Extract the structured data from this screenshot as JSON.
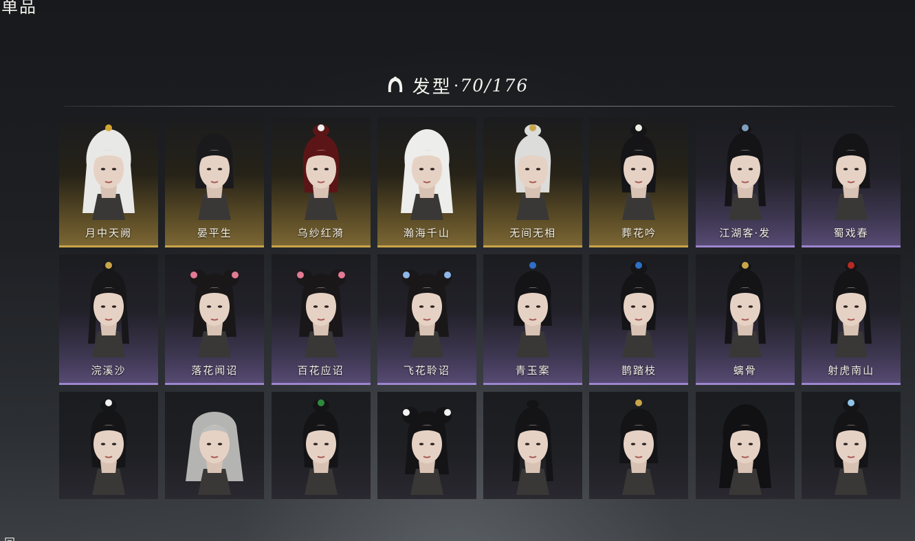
{
  "corner": {
    "title": "单品",
    "bottom_char": "回"
  },
  "header": {
    "title": "发型",
    "separator": "·",
    "count": "70/176"
  },
  "colors": {
    "gold": "#c9a54a",
    "purple": "#9e86cf"
  },
  "items": [
    {
      "label": "月中天阙",
      "rarity": "gold",
      "hair": "#e8e8e6",
      "accent": "#d4a636",
      "style": "long"
    },
    {
      "label": "晏平生",
      "rarity": "gold",
      "hair": "#1a1a1d",
      "accent": "",
      "style": "short"
    },
    {
      "label": "乌纱红漪",
      "rarity": "gold",
      "hair": "#5c1516",
      "accent": "#f0f0f0",
      "style": "bun"
    },
    {
      "label": "瀚海千山",
      "rarity": "gold",
      "hair": "#ededeb",
      "accent": "",
      "style": "long"
    },
    {
      "label": "无间无相",
      "rarity": "gold",
      "hair": "#dcdcda",
      "accent": "#c9a54a",
      "style": "bun"
    },
    {
      "label": "葬花吟",
      "rarity": "gold",
      "hair": "#151518",
      "accent": "#f0ede4",
      "style": "bun"
    },
    {
      "label": "江湖客·发",
      "rarity": "purple",
      "hair": "#141417",
      "accent": "#7f9fbf",
      "style": "pony"
    },
    {
      "label": "蜀戏春",
      "rarity": "purple",
      "hair": "#141417",
      "accent": "",
      "style": "short"
    },
    {
      "label": "浣溪沙",
      "rarity": "purple",
      "hair": "#171619",
      "accent": "#c9a54a",
      "style": "pony"
    },
    {
      "label": "落花闻诏",
      "rarity": "purple",
      "hair": "#1a1719",
      "accent": "#e27a93",
      "style": "buns"
    },
    {
      "label": "百花应诏",
      "rarity": "purple",
      "hair": "#1a1719",
      "accent": "#e27a93",
      "style": "buns"
    },
    {
      "label": "飞花聆诏",
      "rarity": "purple",
      "hair": "#1a1719",
      "accent": "#8fb6e8",
      "style": "buns"
    },
    {
      "label": "青玉案",
      "rarity": "purple",
      "hair": "#141417",
      "accent": "#2f6fc4",
      "style": "short"
    },
    {
      "label": "鹊踏枝",
      "rarity": "purple",
      "hair": "#141417",
      "accent": "#2f6fc4",
      "style": "bun"
    },
    {
      "label": "螭骨",
      "rarity": "purple",
      "hair": "#141417",
      "accent": "#c9a54a",
      "style": "pony"
    },
    {
      "label": "射虎南山",
      "rarity": "purple",
      "hair": "#141417",
      "accent": "#b62a22",
      "style": "pony"
    },
    {
      "label": "",
      "rarity": "plain",
      "hair": "#151518",
      "accent": "#f0f0f0",
      "style": "bun"
    },
    {
      "label": "",
      "rarity": "plain",
      "hair": "#bdbdbb",
      "accent": "",
      "style": "veil"
    },
    {
      "label": "",
      "rarity": "plain",
      "hair": "#141417",
      "accent": "#2f8a3a",
      "style": "bun"
    },
    {
      "label": "",
      "rarity": "plain",
      "hair": "#141417",
      "accent": "#f2f2f2",
      "style": "buns"
    },
    {
      "label": "",
      "rarity": "plain",
      "hair": "#141417",
      "accent": "",
      "style": "pony"
    },
    {
      "label": "",
      "rarity": "plain",
      "hair": "#141417",
      "accent": "#c9a54a",
      "style": "short"
    },
    {
      "label": "",
      "rarity": "plain",
      "hair": "#111114",
      "accent": "",
      "style": "long"
    },
    {
      "label": "",
      "rarity": "plain",
      "hair": "#141417",
      "accent": "#8fc4e8",
      "style": "bun"
    }
  ]
}
